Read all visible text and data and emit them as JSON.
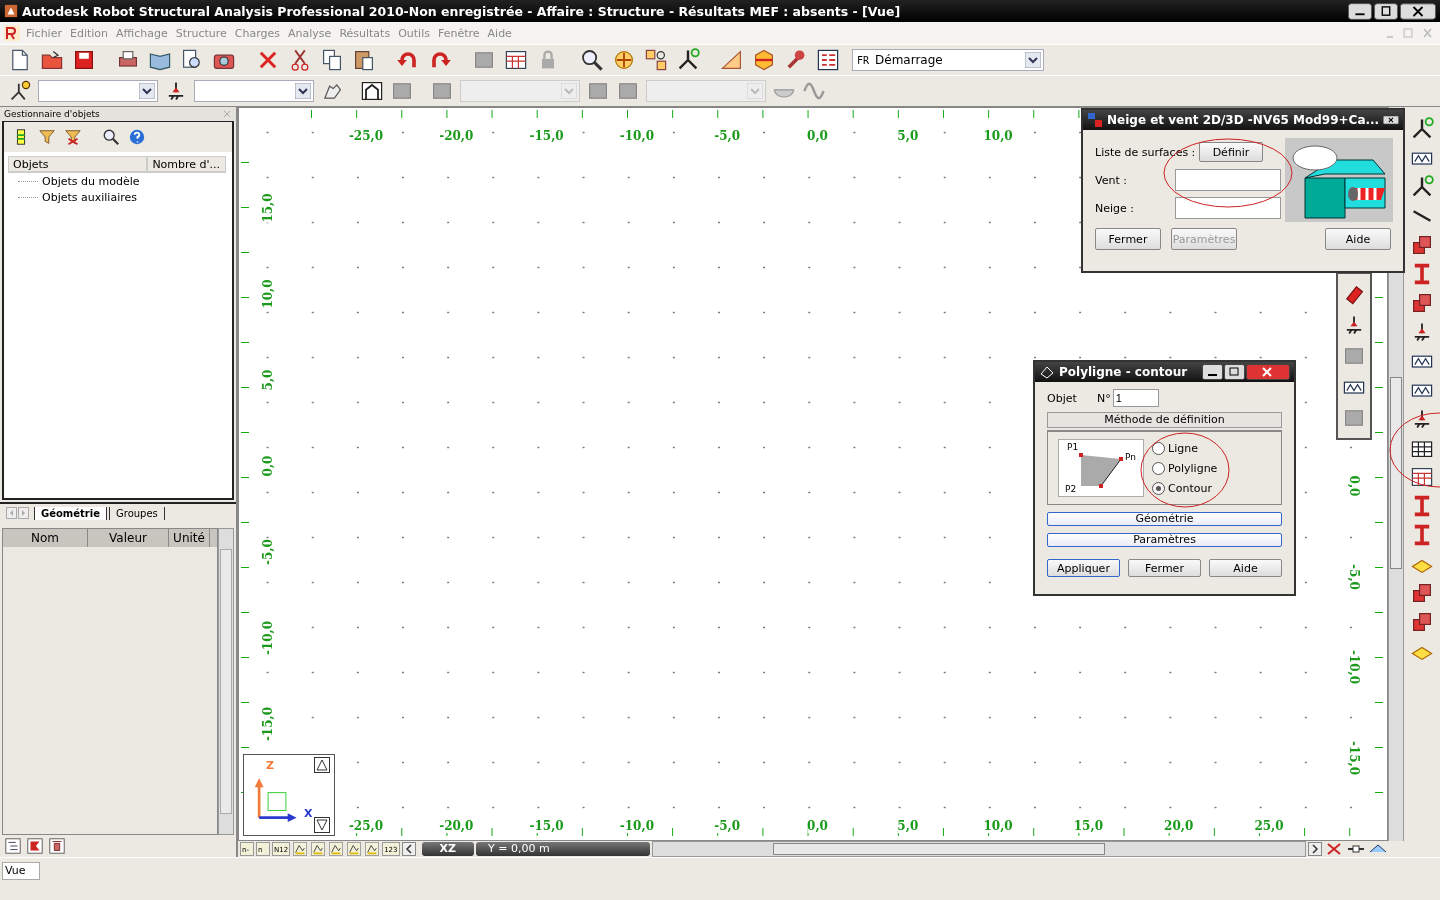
{
  "window": {
    "title": "Autodesk Robot Structural Analysis Professional 2010-Non enregistrée - Affaire : Structure - Résultats MEF : absents - [Vue]"
  },
  "menu": [
    "Fichier",
    "Edition",
    "Affichage",
    "Structure",
    "Charges",
    "Analyse",
    "Résultats",
    "Outils",
    "Fenêtre",
    "Aide"
  ],
  "toolbar": {
    "layout_prefix": "FR",
    "layout_value": "Démarrage"
  },
  "object_manager": {
    "title": "Gestionnaire d'objets",
    "columns": [
      "Objets",
      "Nombre d'..."
    ],
    "items": [
      "Objets du modèle",
      "Objets auxiliaires"
    ],
    "tabs": [
      {
        "label": "Géométrie",
        "selected": true
      },
      {
        "label": "Groupes",
        "selected": false
      }
    ]
  },
  "properties": {
    "columns": [
      "Nom",
      "Valeur",
      "Unité"
    ]
  },
  "view": {
    "top_ruler": [
      "-25,0",
      "-20,0",
      "-15,0",
      "-10,0",
      "-5,0",
      "0,0",
      "5,0",
      "10,0"
    ],
    "bottom_ruler": [
      "-25,0",
      "-20,0",
      "-15,0",
      "-10,0",
      "-5,0",
      "0,0",
      "5,0",
      "10,0",
      "15,0",
      "20,0",
      "25,0"
    ],
    "left_ruler": [
      "15,0",
      "10,0",
      "5,0",
      "0,0",
      "-5,0",
      "-10,0",
      "-15,0"
    ],
    "right_ruler": [
      "0,0",
      "-5,0",
      "-10,0",
      "-15,0"
    ],
    "axis_z": "Z",
    "axis_x": "X",
    "plane": "XZ",
    "position": "Y = 0,00 m",
    "tools": [
      {
        "kind": "text",
        "label": "n-"
      },
      {
        "kind": "text",
        "label": "n"
      },
      {
        "kind": "text",
        "label": "N12"
      },
      {
        "kind": "icon"
      },
      {
        "kind": "icon"
      },
      {
        "kind": "icon"
      },
      {
        "kind": "icon"
      },
      {
        "kind": "icon"
      },
      {
        "kind": "text",
        "label": "123"
      }
    ]
  },
  "snow_dialog": {
    "title": "Neige et vent 2D/3D -NV65 Mod99+Ca...",
    "list_label": "Liste de surfaces :",
    "define_button": "Définir",
    "fields": [
      {
        "label": "Vent :"
      },
      {
        "label": "Neige :"
      }
    ],
    "buttons": [
      {
        "label": "Fermer",
        "disabled": false
      },
      {
        "label": "Paramètres",
        "disabled": true
      },
      {
        "label": "Aide",
        "disabled": false
      }
    ]
  },
  "polyline_dialog": {
    "title": "Polyligne - contour",
    "object_label": "Objet",
    "number_label": "N°",
    "number_value": "1",
    "method_header": "Méthode de définition",
    "diagram_labels": [
      "P1",
      "Pn",
      "P2"
    ],
    "options": [
      {
        "label": "Ligne",
        "selected": false
      },
      {
        "label": "Polyligne",
        "selected": false
      },
      {
        "label": "Contour",
        "selected": true
      }
    ],
    "sections": [
      "Géométrie",
      "Paramètres"
    ],
    "buttons": [
      {
        "label": "Appliquer",
        "default": true
      },
      {
        "label": "Fermer",
        "default": false
      },
      {
        "label": "Aide",
        "default": false
      }
    ]
  },
  "status_bar": {
    "view": "Vue"
  }
}
